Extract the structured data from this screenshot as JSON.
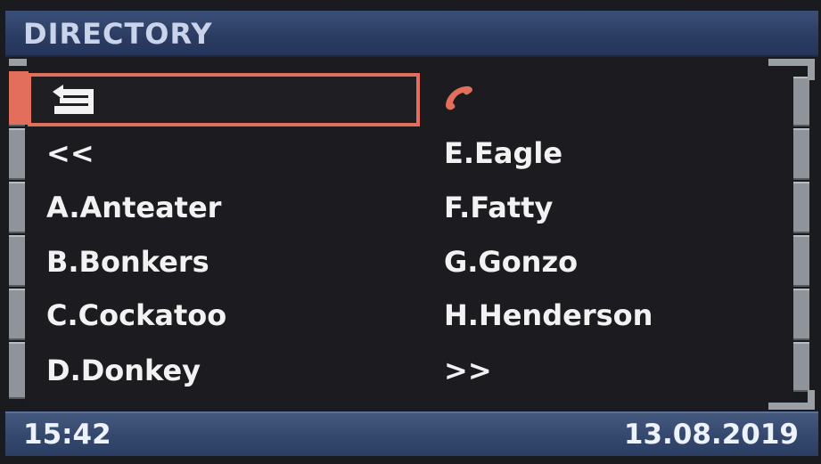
{
  "header": {
    "title": "DIRECTORY"
  },
  "menu": {
    "back_icon": "back-arrow-icon",
    "phone_icon": "phone-handset-icon",
    "left_column": [
      "<<",
      "A.Anteater",
      "B.Bonkers",
      "C.Cockatoo",
      "D.Donkey"
    ],
    "right_column": [
      "E.Eagle",
      "F.Fatty",
      "G.Gonzo",
      "H.Henderson",
      ">>"
    ]
  },
  "footer": {
    "time": "15:42",
    "date": "13.08.2019"
  },
  "colors": {
    "accent": "#e26f5c",
    "title_bar": "#2b3c62",
    "footer_bar": "#34486e",
    "text": "#f2f2f2",
    "background": "#1c1c20"
  }
}
